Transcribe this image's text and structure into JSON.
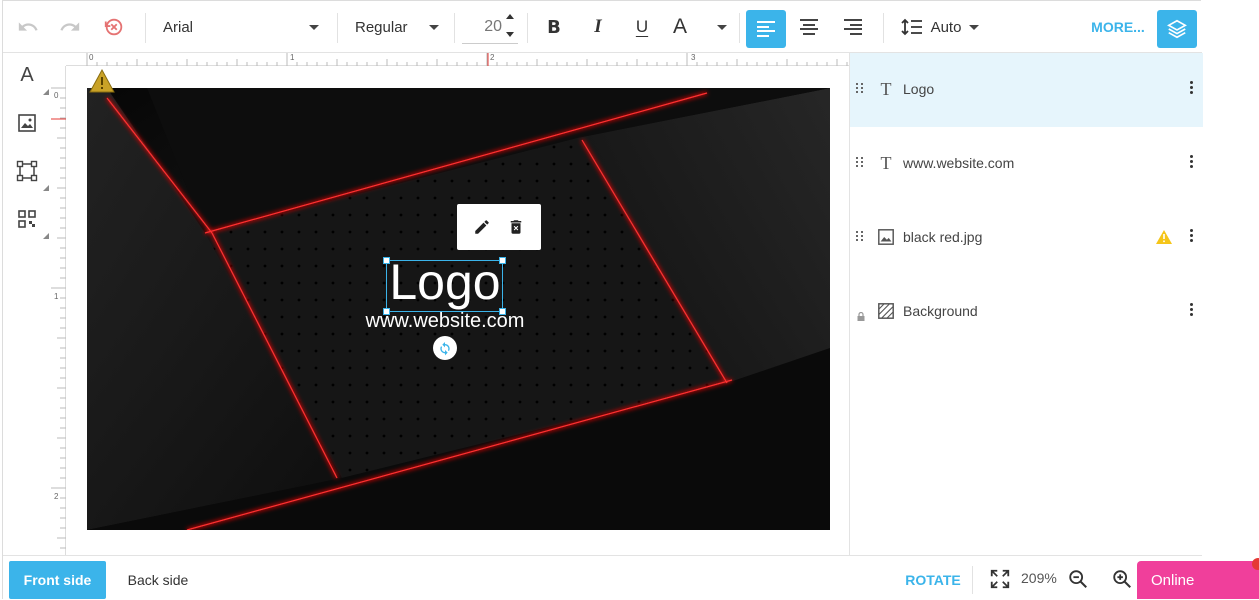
{
  "toolbar": {
    "font_family": "Arial",
    "font_weight": "Regular",
    "font_size": "20",
    "line_height": "Auto",
    "more_label": "MORE...",
    "accent_color": "#3bb4ea"
  },
  "canvas": {
    "ruler_top": [
      "0",
      "1",
      "2",
      "3"
    ],
    "ruler_left": [
      "0",
      "1",
      "2"
    ],
    "logo_text": "Logo",
    "website_text": "www.website.com",
    "warning_icon": "warning-triangle-icon"
  },
  "layers": [
    {
      "name": "Logo",
      "icon": "text-icon",
      "selected": true,
      "warning": false
    },
    {
      "name": "www.website.com",
      "icon": "text-icon",
      "selected": false,
      "warning": false
    },
    {
      "name": "black red.jpg",
      "icon": "image-icon",
      "selected": false,
      "warning": true
    },
    {
      "name": "Background",
      "icon": "background-icon",
      "selected": false,
      "warning": false,
      "locked": true
    }
  ],
  "bottom": {
    "front_side": "Front side",
    "back_side": "Back side",
    "rotate": "ROTATE",
    "zoom": "209%",
    "online": "Online"
  }
}
